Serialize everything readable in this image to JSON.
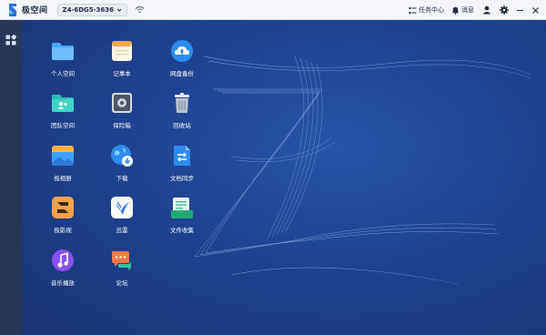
{
  "topbar": {
    "brand_name": "极空间",
    "device_name": "Z4-6DG5-3636",
    "task_center": "任务中心",
    "messages": "消息",
    "user_icon": "user-icon",
    "settings_icon": "gear-icon"
  },
  "apps": [
    {
      "label": "个人空间",
      "icon": "folder-icon"
    },
    {
      "label": "记事本",
      "icon": "notepad-icon"
    },
    {
      "label": "网盘备份",
      "icon": "cloud-upload-icon"
    },
    {
      "label": "团队空间",
      "icon": "team-folder-icon"
    },
    {
      "label": "保险箱",
      "icon": "safe-icon"
    },
    {
      "label": "回收站",
      "icon": "trash-icon"
    },
    {
      "label": "极相册",
      "icon": "photo-album-icon"
    },
    {
      "label": "下载",
      "icon": "download-globe-icon"
    },
    {
      "label": "文档同步",
      "icon": "doc-sync-icon"
    },
    {
      "label": "极影视",
      "icon": "video-icon"
    },
    {
      "label": "迅雷",
      "icon": "thunder-bird-icon"
    },
    {
      "label": "文件收集",
      "icon": "file-collect-icon"
    },
    {
      "label": "音乐播放",
      "icon": "music-icon"
    },
    {
      "label": "论坛",
      "icon": "forum-icon"
    }
  ],
  "colors": {
    "topbar_bg": "#f4f6f9",
    "sidebar_bg": "#263757",
    "desktop_bg": "#1f4391"
  }
}
